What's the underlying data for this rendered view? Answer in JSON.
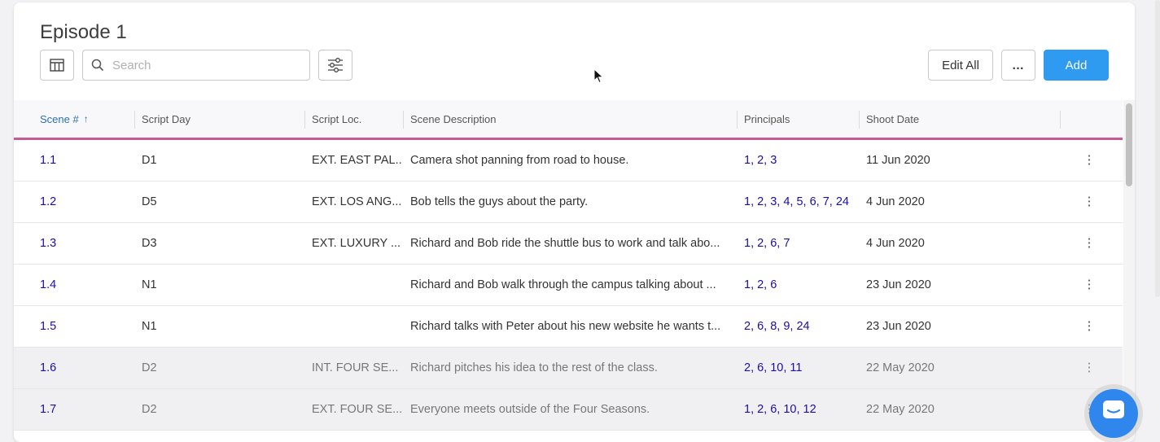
{
  "header": {
    "title": "Episode 1",
    "search_placeholder": "Search",
    "edit_all_label": "Edit All",
    "more_label": "…",
    "add_label": "Add"
  },
  "table": {
    "columns": {
      "scene": "Scene #",
      "sort_indicator": "↑",
      "script_day": "Script Day",
      "script_loc": "Script Loc.",
      "scene_desc": "Scene Description",
      "principals": "Principals",
      "shoot_date": "Shoot Date"
    },
    "rows": [
      {
        "scene": "1.1",
        "day": "D1",
        "loc": "EXT. EAST PAL...",
        "desc": "Camera shot panning from road to house.",
        "principals": "1, 2, 3",
        "date": "11 Jun 2020",
        "menu": "⋮"
      },
      {
        "scene": "1.2",
        "day": "D5",
        "loc": "EXT. LOS ANG...",
        "desc": "Bob tells the guys about the party.",
        "principals": "1, 2, 3, 4, 5, 6, 7, 24",
        "date": "4 Jun 2020",
        "menu": "⋮"
      },
      {
        "scene": "1.3",
        "day": "D3",
        "loc": "EXT. LUXURY ...",
        "desc": "Richard and Bob ride the shuttle bus to work and talk abo...",
        "principals": "1, 2, 6, 7",
        "date": "4 Jun 2020",
        "menu": "⋮"
      },
      {
        "scene": "1.4",
        "day": "N1",
        "loc": "",
        "desc": "Richard and Bob walk through the campus talking about ...",
        "principals": "1, 2, 6",
        "date": "23 Jun 2020",
        "menu": "⋮"
      },
      {
        "scene": "1.5",
        "day": "N1",
        "loc": "",
        "desc": "Richard talks with Peter about his new website he wants t...",
        "principals": "2, 6, 8, 9, 24",
        "date": "23 Jun 2020",
        "menu": "⋮"
      },
      {
        "scene": "1.6",
        "day": "D2",
        "loc": "INT. FOUR SE...",
        "desc": "Richard pitches his idea to the rest of the class.",
        "principals": "2, 6, 10, 11",
        "date": "22 May 2020",
        "menu": "⋮"
      },
      {
        "scene": "1.7",
        "day": "D2",
        "loc": "EXT. FOUR SE...",
        "desc": "Everyone meets outside of the Four Seasons.",
        "principals": "1, 2, 6, 10, 12",
        "date": "22 May 2020",
        "menu": "⋮"
      }
    ]
  },
  "colors": {
    "accent": "#2f9bf0",
    "header_divider": "#c75a93",
    "link": "#1a0dab",
    "sorted_column": "#2c6fb3"
  },
  "icons": {
    "columns": "table-columns-icon",
    "search": "search-icon",
    "filter": "sliders-icon",
    "chat": "chat-icon"
  }
}
